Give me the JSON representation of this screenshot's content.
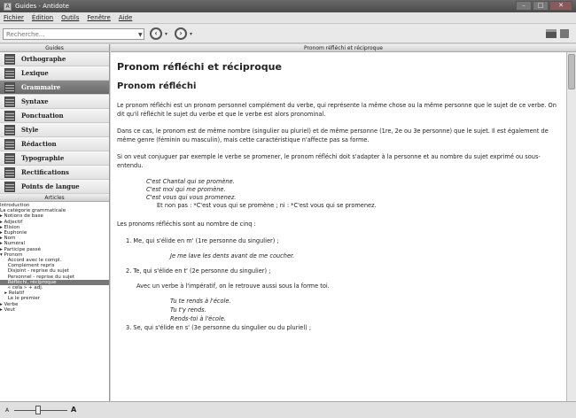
{
  "window": {
    "title": "Guides - Antidote"
  },
  "menu": [
    "Fichier",
    "Édition",
    "Outils",
    "Fenêtre",
    "Aide"
  ],
  "toolbar": {
    "search_placeholder": "Recherche..."
  },
  "guides_header": "Guides",
  "guides": [
    {
      "label": "Orthographe",
      "active": false
    },
    {
      "label": "Lexique",
      "active": false
    },
    {
      "label": "Grammaire",
      "active": true
    },
    {
      "label": "Syntaxe",
      "active": false
    },
    {
      "label": "Ponctuation",
      "active": false
    },
    {
      "label": "Style",
      "active": false
    },
    {
      "label": "Rédaction",
      "active": false
    },
    {
      "label": "Typographie",
      "active": false
    },
    {
      "label": "Rectifications",
      "active": false
    },
    {
      "label": "Points de langue",
      "active": false
    }
  ],
  "articles_header": "Articles",
  "articles": [
    "Introduction",
    "La catégorie grammaticale",
    "▸ Notions de base",
    "▸ Adjectif",
    "▸ Élision",
    "▸ Euphonie",
    "▸ Nom",
    "▸ Numéral",
    "▸ Participe passé",
    "▾ Pronom",
    "     Accord avec le compl.",
    "     Complément repris",
    "     Disjoint - reprise du sujet",
    "     Personnel - reprise du sujet",
    "     Réfléchi, réciproque",
    "     « cela » + adj.",
    "   ▸ Relatif",
    "     Le le premier",
    "▸ Verbe",
    "▸ Veut"
  ],
  "selected_article_index": 14,
  "content_header": "Pronom réfléchi et réciproque",
  "content": {
    "title": "Pronom réfléchi et réciproque",
    "subtitle": "Pronom réfléchi",
    "p1": "Le pronom réfléchi est un pronom personnel complément du verbe, qui représente la même chose ou la même personne que le sujet de ce verbe. On dit qu'il réfléchit le sujet du verbe et que le verbe est alors pronominal.",
    "p2": "Dans ce cas, le pronom est de même nombre (singulier ou pluriel) et de même personne (1re, 2e ou 3e personne) que le sujet. Il est également de même genre (féminin ou masculin), mais cette caractéristique n'affecte pas sa forme.",
    "p3": "Si on veut conjuguer par exemple le verbe se promener, le pronom réfléchi doit s'adapter à la personne et au nombre du sujet exprimé ou sous-entendu.",
    "ex1": "C'est Chantal qui se promène.",
    "ex2": "C'est moi qui me promène.",
    "ex3": "C'est vous qui vous promenez.",
    "ex_note": "Et non pas : *C'est vous qui se promène ; ni : *C'est vous qui se promenez.",
    "p4": "Les pronoms réfléchis sont au nombre de cinq :",
    "item1": "1.  Me, qui s'élide en m' (1re personne du singulier) ;",
    "item1_ex": "Je me lave les dents avant de me coucher.",
    "item2": "2.  Te, qui s'élide en t' (2e personne du singulier) ;",
    "item2_note": "Avec un verbe à l'impératif, on le retrouve aussi sous la forme toi.",
    "item2_ex1": "Tu te rends à l'école.",
    "item2_ex2": "Tu t'y rends.",
    "item2_ex3": "Rends-toi à l'école.",
    "item3": "3.  Se, qui s'élide en s' (3e personne du singulier ou du pluriel) ;"
  }
}
